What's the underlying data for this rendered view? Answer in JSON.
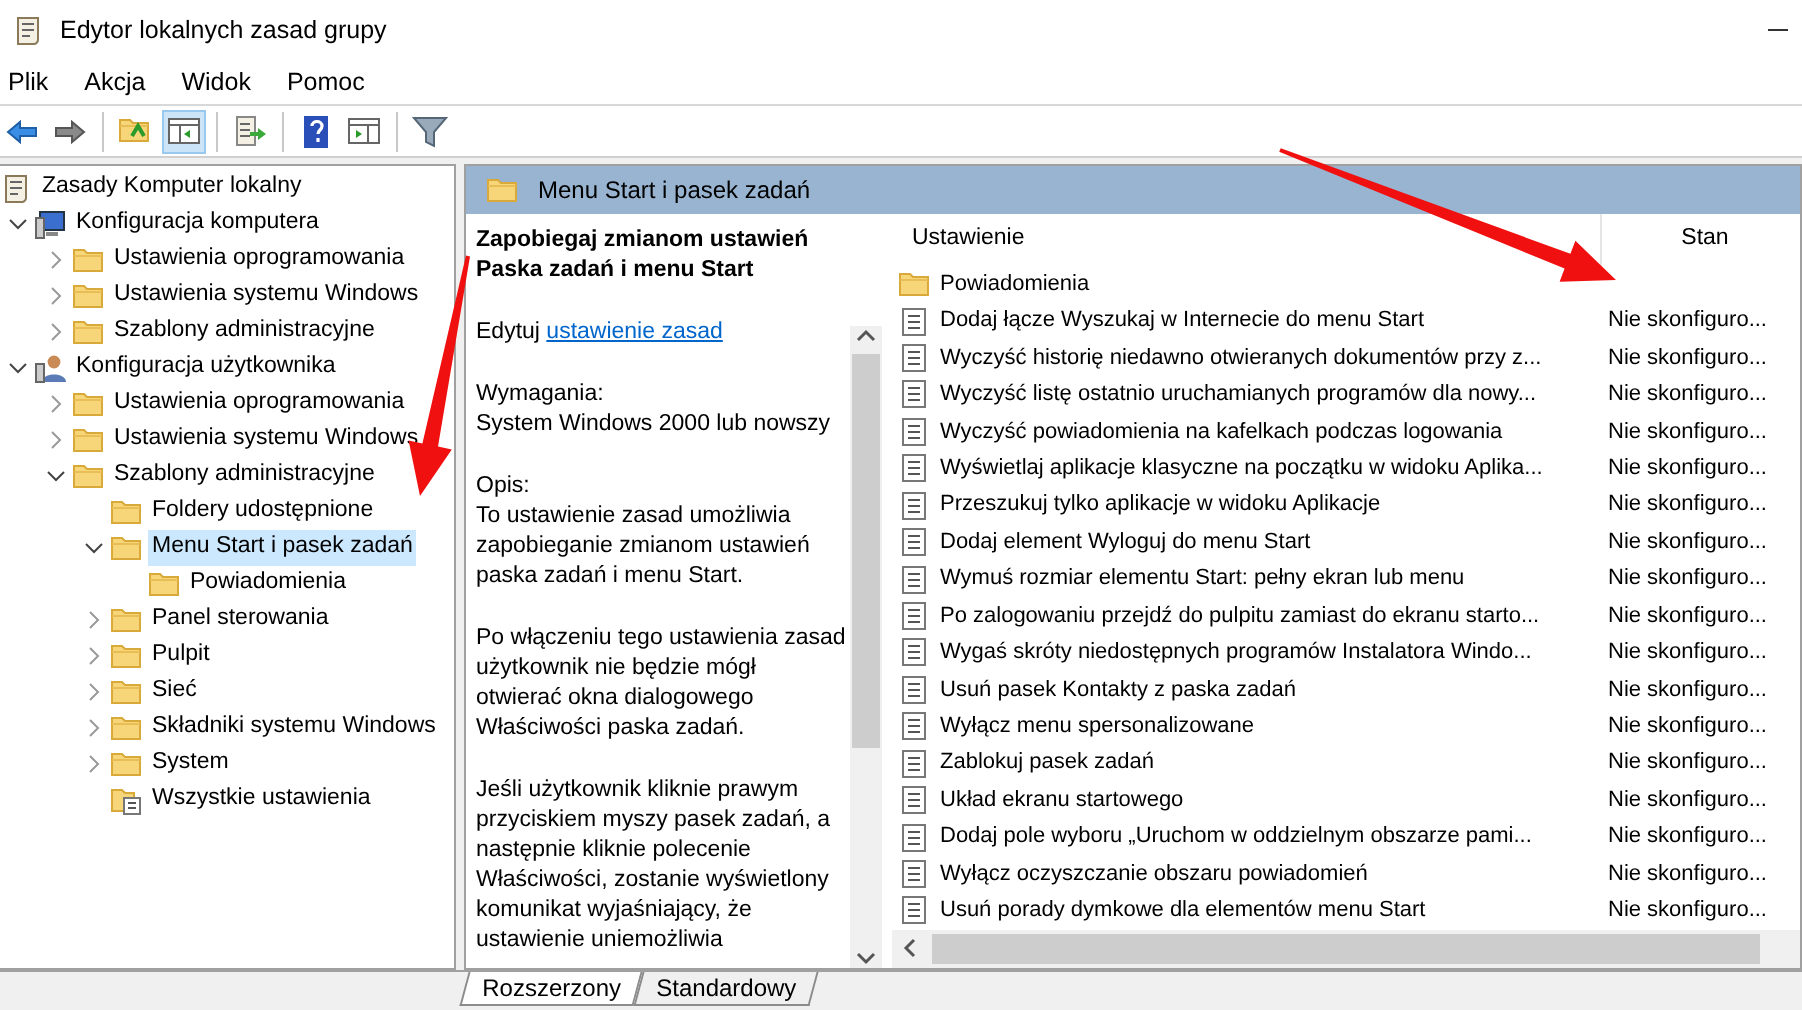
{
  "window": {
    "title": "Edytor lokalnych zasad grupy"
  },
  "menu": [
    "Plik",
    "Akcja",
    "Widok",
    "Pomoc"
  ],
  "toolbar": [
    {
      "kind": "back",
      "selected": false
    },
    {
      "kind": "forward",
      "selected": false
    },
    {
      "kind": "up",
      "selected": false
    },
    {
      "kind": "tree",
      "selected": true
    },
    {
      "kind": "export",
      "selected": false
    },
    {
      "kind": "help",
      "selected": false
    },
    {
      "kind": "pane",
      "selected": false
    },
    {
      "kind": "filter",
      "selected": false
    }
  ],
  "tree": [
    {
      "label": "Zasady Komputer lokalny",
      "kind": "root",
      "selected": false,
      "children": [
        {
          "label": "Konfiguracja komputera",
          "kind": "computer",
          "expanded": true,
          "selected": false,
          "children": [
            {
              "label": "Ustawienia oprogramowania",
              "kind": "folder",
              "expanded": false,
              "selected": false
            },
            {
              "label": "Ustawienia systemu Windows",
              "kind": "folder",
              "expanded": false,
              "selected": false
            },
            {
              "label": "Szablony administracyjne",
              "kind": "folder",
              "expanded": false,
              "selected": false
            }
          ]
        },
        {
          "label": "Konfiguracja użytkownika",
          "kind": "user",
          "expanded": true,
          "selected": false,
          "children": [
            {
              "label": "Ustawienia oprogramowania",
              "kind": "folder",
              "expanded": false,
              "selected": false
            },
            {
              "label": "Ustawienia systemu Windows",
              "kind": "folder",
              "expanded": false,
              "selected": false
            },
            {
              "label": "Szablony administracyjne",
              "kind": "folder",
              "expanded": true,
              "selected": false,
              "children": [
                {
                  "label": "Foldery udostępnione",
                  "kind": "folder",
                  "selected": false
                },
                {
                  "label": "Menu Start i pasek zadań",
                  "kind": "folder",
                  "expanded": true,
                  "selected": true,
                  "children": [
                    {
                      "label": "Powiadomienia",
                      "kind": "folder",
                      "selected": false
                    }
                  ]
                },
                {
                  "label": "Panel sterowania",
                  "kind": "folder",
                  "expanded": false,
                  "selected": false
                },
                {
                  "label": "Pulpit",
                  "kind": "folder",
                  "expanded": false,
                  "selected": false
                },
                {
                  "label": "Sieć",
                  "kind": "folder",
                  "expanded": false,
                  "selected": false
                },
                {
                  "label": "Składniki systemu Windows",
                  "kind": "folder",
                  "expanded": false,
                  "selected": false
                },
                {
                  "label": "System",
                  "kind": "folder",
                  "expanded": false,
                  "selected": false
                },
                {
                  "label": "Wszystkie ustawienia",
                  "kind": "all",
                  "selected": false
                }
              ]
            }
          ]
        }
      ]
    }
  ],
  "pane_header": "Menu Start i pasek zadań",
  "description": {
    "title": "Zapobiegaj zmianom ustawień Paska zadań i menu Start",
    "edit_prefix": "Edytuj",
    "edit_link": "ustawienie zasad",
    "sections": [
      "Wymagania:\nSystem Windows 2000 lub nowszy",
      "Opis:\nTo ustawienie zasad umożliwia zapobieganie zmianom ustawień paska zadań i menu Start.",
      "Po włączeniu tego ustawienia zasad użytkownik nie będzie mógł otwierać okna dialogowego Właściwości paska zadań.",
      "Jeśli użytkownik kliknie prawym przyciskiem myszy pasek zadań, a następnie kliknie polecenie Właściwości, zostanie wyświetlony komunikat wyjaśniający, że ustawienie uniemożliwia"
    ]
  },
  "table": {
    "columns": [
      "Ustawienie",
      "Stan"
    ],
    "rows": [
      {
        "kind": "folder",
        "name": "Powiadomienia",
        "state": ""
      },
      {
        "kind": "setting",
        "name": "Dodaj łącze Wyszukaj w Internecie do menu Start",
        "state": "Nie skonfiguro..."
      },
      {
        "kind": "setting",
        "name": "Wyczyść historię niedawno otwieranych dokumentów przy z...",
        "state": "Nie skonfiguro..."
      },
      {
        "kind": "setting",
        "name": "Wyczyść listę ostatnio uruchamianych programów dla nowy...",
        "state": "Nie skonfiguro..."
      },
      {
        "kind": "setting",
        "name": "Wyczyść powiadomienia na kafelkach podczas logowania",
        "state": "Nie skonfiguro..."
      },
      {
        "kind": "setting",
        "name": "Wyświetlaj aplikacje klasyczne na początku w widoku Aplika...",
        "state": "Nie skonfiguro..."
      },
      {
        "kind": "setting",
        "name": "Przeszukuj tylko aplikacje w widoku Aplikacje",
        "state": "Nie skonfiguro..."
      },
      {
        "kind": "setting",
        "name": "Dodaj element Wyloguj do menu Start",
        "state": "Nie skonfiguro..."
      },
      {
        "kind": "setting",
        "name": "Wymuś rozmiar elementu Start: pełny ekran lub menu",
        "state": "Nie skonfiguro..."
      },
      {
        "kind": "setting",
        "name": "Po zalogowaniu przejdź do pulpitu zamiast do ekranu starto...",
        "state": "Nie skonfiguro..."
      },
      {
        "kind": "setting",
        "name": "Wygaś skróty niedostępnych programów Instalatora Windo...",
        "state": "Nie skonfiguro..."
      },
      {
        "kind": "setting",
        "name": "Usuń pasek Kontakty z paska zadań",
        "state": "Nie skonfiguro..."
      },
      {
        "kind": "setting",
        "name": "Wyłącz menu spersonalizowane",
        "state": "Nie skonfiguro..."
      },
      {
        "kind": "setting",
        "name": "Zablokuj pasek zadań",
        "state": "Nie skonfiguro..."
      },
      {
        "kind": "setting",
        "name": "Układ ekranu startowego",
        "state": "Nie skonfiguro..."
      },
      {
        "kind": "setting",
        "name": "Dodaj pole wyboru „Uruchom w oddzielnym obszarze pami...",
        "state": "Nie skonfiguro..."
      },
      {
        "kind": "setting",
        "name": "Wyłącz oczyszczanie obszaru powiadomień",
        "state": "Nie skonfiguro..."
      },
      {
        "kind": "setting",
        "name": "Usuń porady dymkowe dla elementów menu Start",
        "state": "Nie skonfiguro..."
      }
    ]
  },
  "bottom_tabs": [
    {
      "label": "Rozszerzony",
      "selected": true
    },
    {
      "label": "Standardowy",
      "selected": false
    }
  ],
  "annotations": [
    {
      "kind": "arrow"
    },
    {
      "kind": "arrow"
    }
  ]
}
